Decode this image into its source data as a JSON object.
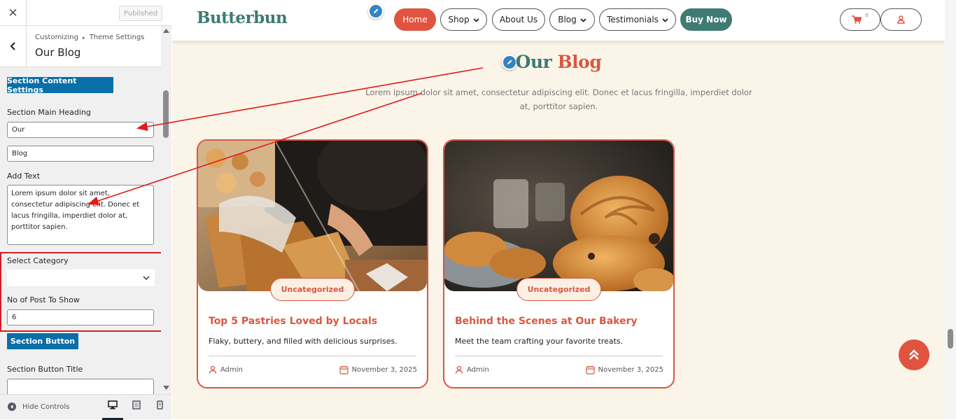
{
  "customizer": {
    "close_label": "✕",
    "published_label": "Published",
    "breadcrumb_root": "Customizing",
    "breadcrumb_separator": "▸",
    "breadcrumb_section": "Theme Settings",
    "panel_title": "Our Blog",
    "section_content_button": "Section Content Settings",
    "main_heading_label": "Section Main Heading",
    "main_heading_value_1": "Our",
    "main_heading_value_2": "Blog",
    "add_text_label": "Add Text",
    "add_text_value": "Lorem ipsum dolor sit amet, consectetur adipiscing elit. Donec et lacus fringilla, imperdiet dolor at, porttitor sapien.",
    "select_category_label": "Select Category",
    "select_category_value": "",
    "post_count_label": "No of Post To Show",
    "post_count_value": "6",
    "section_button_label": "Section Button",
    "section_button_title_label": "Section Button Title",
    "section_button_title_value": "",
    "hide_controls_label": "Hide Controls",
    "devices": [
      "desktop-icon",
      "tablet-icon",
      "mobile-icon"
    ]
  },
  "site": {
    "logo": "Butterbun",
    "nav": {
      "home": "Home",
      "shop": "Shop",
      "about": "About Us",
      "blog": "Blog",
      "testimonials": "Testimonials",
      "buy_now": "Buy Now",
      "cart_count": "0"
    },
    "blog_section": {
      "heading_first": "Our",
      "heading_second": "Blog",
      "subtitle": "Lorem ipsum dolor sit amet, consectetur adipiscing elit. Donec et lacus fringilla, imperdiet dolor at, porttitor sapien."
    },
    "posts": [
      {
        "category": "Uncategorized",
        "title": "Top 5 Pastries Loved by Locals",
        "excerpt": "Flaky, buttery, and filled with delicious surprises.",
        "author": "Admin",
        "date": "November 3, 2025"
      },
      {
        "category": "Uncategorized",
        "title": "Behind the Scenes at Our Bakery",
        "excerpt": "Meet the team crafting your favorite treats.",
        "author": "Admin",
        "date": "November 3, 2025"
      }
    ]
  },
  "colors": {
    "accent_red": "#d85840",
    "accent_teal": "#3d7a73",
    "wp_blue": "#0a6ea8",
    "highlight_red": "#d21f25",
    "preview_bg": "#fbf4e8"
  }
}
